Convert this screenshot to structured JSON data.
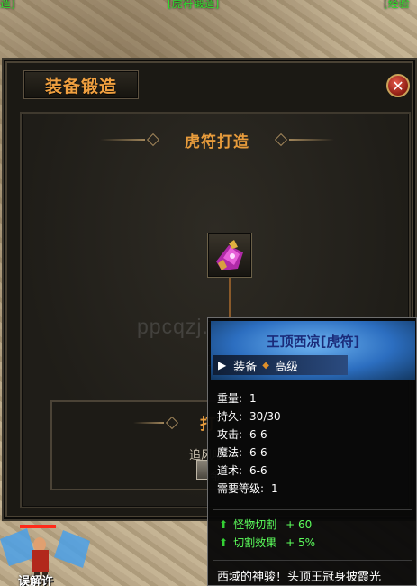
{
  "background": {
    "labels": {
      "left": "造]",
      "middle": "[虎符锻造]",
      "right": "[经验"
    }
  },
  "window": {
    "title": "装备锻造",
    "close_label": "✕"
  },
  "craft": {
    "title": "虎符打造",
    "input_item_icon": "pink-armor-item-icon",
    "output_item_icon": "pink-armor-item-icon"
  },
  "lower_panel": {
    "title_partial": "打",
    "line1_partial": "追风吲",
    "line2_partial": "金"
  },
  "watermark": "ppcqzj.com",
  "character": {
    "name": "误解许",
    "hp_percent": 100
  },
  "tooltip": {
    "item_name": "王顶西凉[虎符]",
    "type": "装备",
    "grade": "高级",
    "stats": [
      {
        "label": "重量:",
        "value": "1"
      },
      {
        "label": "持久:",
        "value": "30/30"
      },
      {
        "label": "攻击:",
        "value": "6-6"
      },
      {
        "label": "魔法:",
        "value": "6-6"
      },
      {
        "label": "道术:",
        "value": "6-6"
      },
      {
        "label": "需要等级:",
        "value": "1"
      }
    ],
    "bonuses": [
      {
        "label": "怪物切割",
        "value": "60"
      },
      {
        "label": "切割效果",
        "value": "5%"
      }
    ],
    "description": "西域的神骏！头顶王冠身披霞光"
  },
  "colors": {
    "title_orange": "#f0a040",
    "bonus_green": "#5cff5c",
    "header_blue": "#2c6ec0"
  }
}
